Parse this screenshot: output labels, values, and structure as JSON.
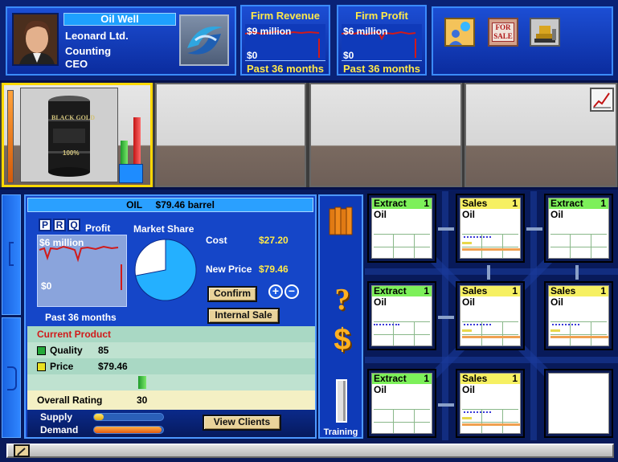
{
  "header": {
    "company_type": "Oil Well",
    "company_name": "Leonard Ltd.",
    "department": "Counting",
    "role": "CEO",
    "revenue": {
      "title": "Firm Revenue",
      "top_value": "$9 million",
      "bottom_value": "$0",
      "period": "Past 36 months"
    },
    "profit": {
      "title": "Firm Profit",
      "top_value": "$6 million",
      "bottom_value": "$0",
      "period": "Past 36 months"
    },
    "for_sale_label": "FOR SALE"
  },
  "product_strip": {
    "barrel_label": "BLACK GOLD",
    "barrel_caption": "100%"
  },
  "detail": {
    "title_product": "OIL",
    "title_price": "$79.46 barrel",
    "tabs": [
      "P",
      "R",
      "Q"
    ],
    "profit_label": "Profit",
    "profit_top": "$6 million",
    "profit_bottom": "$0",
    "period": "Past 36 months",
    "market_share_label": "Market Share",
    "market_share_pct": 0.72,
    "cost_label": "Cost",
    "cost_value": "$27.20",
    "new_price_label": "New Price",
    "new_price_value": "$79.46",
    "confirm_label": "Confirm",
    "internal_sale_label": "Internal Sale",
    "current_product_label": "Current Product",
    "quality_label": "Quality",
    "quality_value": "85",
    "price_label": "Price",
    "price_value": "$79.46",
    "overall_rating_label": "Overall Rating",
    "overall_rating_value": "30",
    "supply_label": "Supply",
    "demand_label": "Demand",
    "supply_level": 0.14,
    "demand_level": 0.98,
    "view_clients_label": "View Clients"
  },
  "tools": {
    "help_glyph": "?",
    "money_glyph": "$",
    "training_label": "Training"
  },
  "grid": [
    {
      "type": "Extract",
      "num": "1",
      "product": "Oil",
      "color": "#7df05a",
      "kind": "extract"
    },
    {
      "type": "Sales",
      "num": "1",
      "product": "Oil",
      "color": "#f6f062",
      "kind": "sales"
    },
    {
      "type": "Extract",
      "num": "1",
      "product": "Oil",
      "color": "#7df05a",
      "kind": "extract"
    },
    {
      "type": "Extract",
      "num": "1",
      "product": "Oil",
      "color": "#7df05a",
      "kind": "extract2"
    },
    {
      "type": "Sales",
      "num": "1",
      "product": "Oil",
      "color": "#f6f062",
      "kind": "sales"
    },
    {
      "type": "Sales",
      "num": "1",
      "product": "Oil",
      "color": "#f6f062",
      "kind": "sales"
    },
    {
      "type": "Extract",
      "num": "1",
      "product": "Oil",
      "color": "#7df05a",
      "kind": "extract"
    },
    {
      "type": "Sales",
      "num": "1",
      "product": "Oil",
      "color": "#f6f062",
      "kind": "sales"
    },
    {
      "type": "",
      "num": "",
      "product": "",
      "color": "#ffffff",
      "kind": "empty"
    }
  ],
  "colors": {
    "accent_yellow": "#ffe94a",
    "panel_blue": "#1c4ed4",
    "profit_line": "#d11a1a",
    "pie_blue": "#24b0ff",
    "quality_green": "#24a83a",
    "price_yellow": "#e8e020"
  }
}
